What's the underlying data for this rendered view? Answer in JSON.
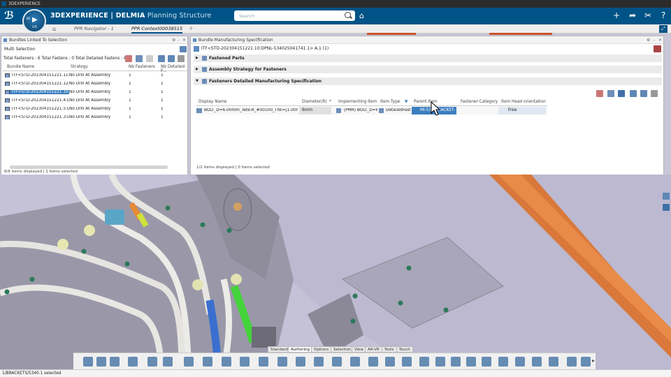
{
  "os_title": "3DEXPERIENCE",
  "app": {
    "brand_bold": "3DEXPERIENCE | DELMIA",
    "module": "Planning Structure"
  },
  "compass": {
    "version": "V.R",
    "number": "3D"
  },
  "search": {
    "placeholder": "Search"
  },
  "tabs": [
    {
      "label": "PPR Navigator - 1"
    },
    {
      "label": "PPR Context00038515"
    }
  ],
  "left_panel": {
    "title": "Bundles Linked To Selection",
    "selection_mode": "Multi Selection",
    "totals": "Total Fasteners : 6 Total Fastens : 0 Total Detailed Fastens : 6",
    "columns": [
      "Bundle Name",
      "Strategy",
      "Nb Fasteners",
      "Nb Detailed F..."
    ],
    "rows": [
      {
        "name": "ITF<STD-202304151221.11:DP",
        "strategy": "No Drill At Assembly",
        "nb": "1",
        "nbd": "1",
        "selected": false
      },
      {
        "name": "ITF<STD-202304151221.12:DP",
        "strategy": "No Drill At Assembly",
        "nb": "1",
        "nbd": "1",
        "selected": false
      },
      {
        "name": "ITF<STD-202304151221.10:DP",
        "strategy": "No Drill At Assembly",
        "nb": "1",
        "nbd": "1",
        "selected": true
      },
      {
        "name": "ITF<STD-202304151221.4:DPN",
        "strategy": "No Drill At Assembly",
        "nb": "1",
        "nbd": "1",
        "selected": false
      },
      {
        "name": "ITF<STD-202304151221.5:DPN",
        "strategy": "No Drill At Assembly",
        "nb": "1",
        "nbd": "1",
        "selected": false
      },
      {
        "name": "ITF<STD-202304151221.3:DPN",
        "strategy": "No Drill At Assembly",
        "nb": "1",
        "nbd": "1",
        "selected": false
      }
    ],
    "footer": "6/6 items displayed | 1 items selected"
  },
  "right_panel": {
    "title": "Bundle Manufacturing Specification",
    "context": "ITF<STD-202304151221.10:DPNL-534025041741.1> A.1 (1)",
    "sections": [
      {
        "label": "Fastened Parts",
        "expanded": false
      },
      {
        "label": "Assembly Strategy for Fasteners",
        "expanded": false
      },
      {
        "label": "Fasteners Detailed Manufacturing Specification",
        "expanded": true
      }
    ],
    "columns": [
      "Display Name",
      "Diameter(R)",
      "*",
      "Implementing Item",
      "Item Type",
      "Parent Item",
      "Fastener Category",
      "Item Head orientation"
    ],
    "row": {
      "display_name": "BOLT_D=6.00mm_Tete-R_#00100_Thk=[1.00mm,5...",
      "diameter": "6mm",
      "implementing_item": "(PMR) BOLT_D=6...",
      "item_type": "DetailedFast...",
      "parent_item": "MI-53...BRACKET-",
      "fastener_category": "",
      "head_orientation": "Free"
    },
    "footer": "1/2 items displayed | 0 items selected"
  },
  "command_tabs": [
    "Standard",
    "Authoring",
    "Options",
    "Selection",
    "View",
    "AR-VR",
    "Tools",
    "Touch"
  ],
  "active_command_tab": "Authoring",
  "status_bar": "1/BRACKETS/5340.1 selected",
  "colors": {
    "brand": "#005386",
    "selection": "#3c7fbf",
    "panel_bg": "#ffffff",
    "viewport": "#c5c2d8"
  }
}
